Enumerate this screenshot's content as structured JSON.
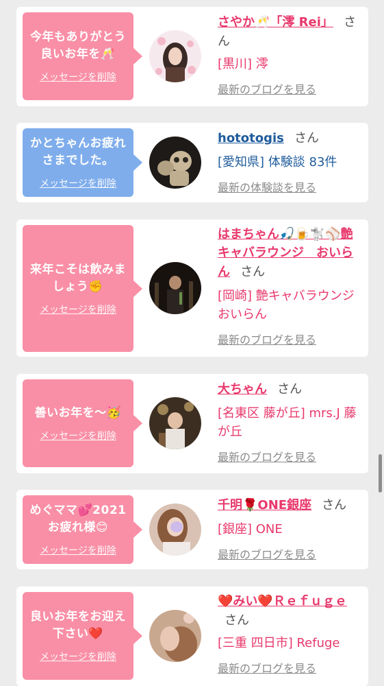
{
  "cards": [
    {
      "message": "今年もありがとう良いお年を🥂",
      "delete_label": "メッセージを削除",
      "name": "さやか🥂「澪 Rei」",
      "san": "さん",
      "location": "[黒川] 澪",
      "link": "最新のブログを見る",
      "theme": "pink"
    },
    {
      "message": "かとちゃんお疲れさまでした。",
      "delete_label": "メッセージを削除",
      "name": "hototogis",
      "san": "さん",
      "location": "[愛知県] 体験談 83件",
      "link": "最新の体験談を見る",
      "theme": "blue"
    },
    {
      "message": "来年こそは飲みましょう✊",
      "delete_label": "メッセージを削除",
      "name": "はまちゃん🎣🍺🐩⚾艶キャバラウンジ　おいらん",
      "san": "さん",
      "location": "[岡崎] 艶キャバラウンジ おいらん",
      "link": "最新のブログを見る",
      "theme": "pink"
    },
    {
      "message": "善いお年を〜🥳",
      "delete_label": "メッセージを削除",
      "name": "大ちゃん",
      "san": "さん",
      "location": "[名東区 藤が丘] mrs.J 藤が丘",
      "link": "最新のブログを見る",
      "theme": "pink"
    },
    {
      "message": "めぐママ💕2021お疲れ様😊",
      "delete_label": "メッセージを削除",
      "name": "千明🌹ONE銀座",
      "san": "さん",
      "location": "[銀座] ONE",
      "link": "最新のブログを見る",
      "theme": "pink"
    },
    {
      "message": "良いお年をお迎え下さい❤️",
      "delete_label": "メッセージを削除",
      "name": "❤️みい❤️Ｒｅｆｕｇｅ",
      "san": "さん",
      "location": "[三重 四日市] Refuge",
      "link": "最新のブログを見る",
      "theme": "pink"
    }
  ]
}
